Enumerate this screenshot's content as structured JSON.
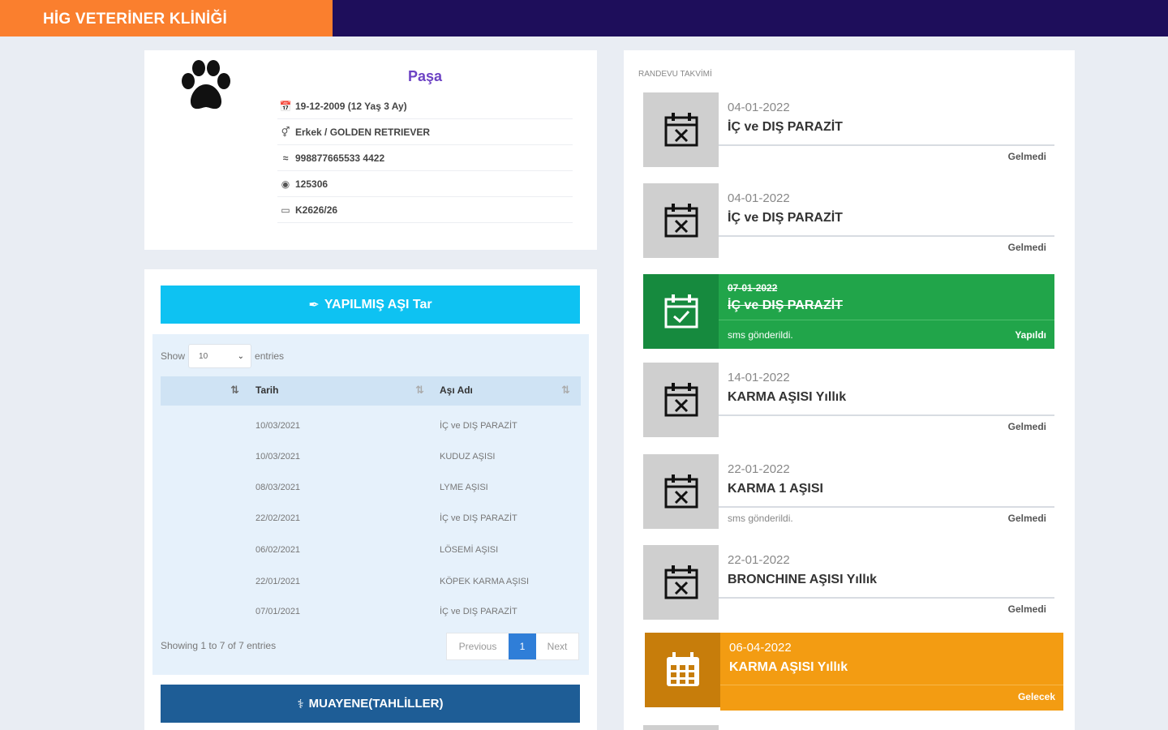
{
  "header": {
    "brand": "HİG VETERİNER KLİNİĞİ"
  },
  "profile": {
    "name": "Paşa",
    "birth": "19-12-2009 (12 Yaş 3 Ay)",
    "gender_breed": "Erkek / GOLDEN RETRIEVER",
    "chip": "998877665533 4422",
    "id": "125306",
    "card": "K2626/26"
  },
  "vaccines": {
    "add_button": "YAPILMIŞ AŞI Tar",
    "show_label": "Show",
    "entries_select": "10",
    "entries_label": "entries",
    "columns": [
      "Tarih",
      "Aşı Adı"
    ],
    "rows": [
      [
        "10/03/2021",
        "İÇ ve DIŞ PARAZİT"
      ],
      [
        "10/03/2021",
        "KUDUZ AŞISI"
      ],
      [
        "08/03/2021",
        "LYME AŞISI"
      ],
      [
        "22/02/2021",
        "İÇ ve DIŞ PARAZİT"
      ],
      [
        "06/02/2021",
        "LÖSEMİ AŞISI"
      ],
      [
        "22/01/2021",
        "KÖPEK KARMA AŞISI"
      ],
      [
        "07/01/2021",
        "İÇ ve DIŞ PARAZİT"
      ]
    ],
    "showing": "Showing 1 to 7 of 7 entries",
    "pager": {
      "prev": "Previous",
      "current": "1",
      "next": "Next"
    },
    "exam_button": "MUAYENE(TAHLİLLER)"
  },
  "calendar": {
    "title": "RANDEVU TAKVİMİ",
    "appointments": [
      {
        "date": "04-01-2022",
        "title": "İÇ ve DIŞ PARAZİT",
        "note": "",
        "status": "Gelmedi"
      },
      {
        "date": "04-01-2022",
        "title": "İÇ ve DIŞ PARAZİT",
        "note": "",
        "status": "Gelmedi"
      },
      {
        "date": "07-01-2022",
        "title": "İÇ ve DIŞ PARAZİT",
        "note": "sms gönderildi.",
        "status": "Yapıldı"
      },
      {
        "date": "14-01-2022",
        "title": "KARMA AŞISI Yıllık",
        "note": "",
        "status": "Gelmedi"
      },
      {
        "date": "22-01-2022",
        "title": "KARMA 1 AŞISI",
        "note": "sms gönderildi.",
        "status": "Gelmedi"
      },
      {
        "date": "22-01-2022",
        "title": "BRONCHINE AŞISI Yıllık",
        "note": "",
        "status": "Gelmedi"
      },
      {
        "date": "06-04-2022",
        "title": "KARMA AŞISI Yıllık",
        "note": "",
        "status": "Gelecek"
      }
    ]
  },
  "colors": {
    "brand_orange": "#fa7f2e",
    "header_navy": "#1e0e5b",
    "accent_cyan": "#0ec2f2",
    "button_navy": "#1e5d96",
    "done_green": "#21a54a",
    "future_orange": "#f39c12",
    "missed_gray": "#cfcfcf"
  }
}
